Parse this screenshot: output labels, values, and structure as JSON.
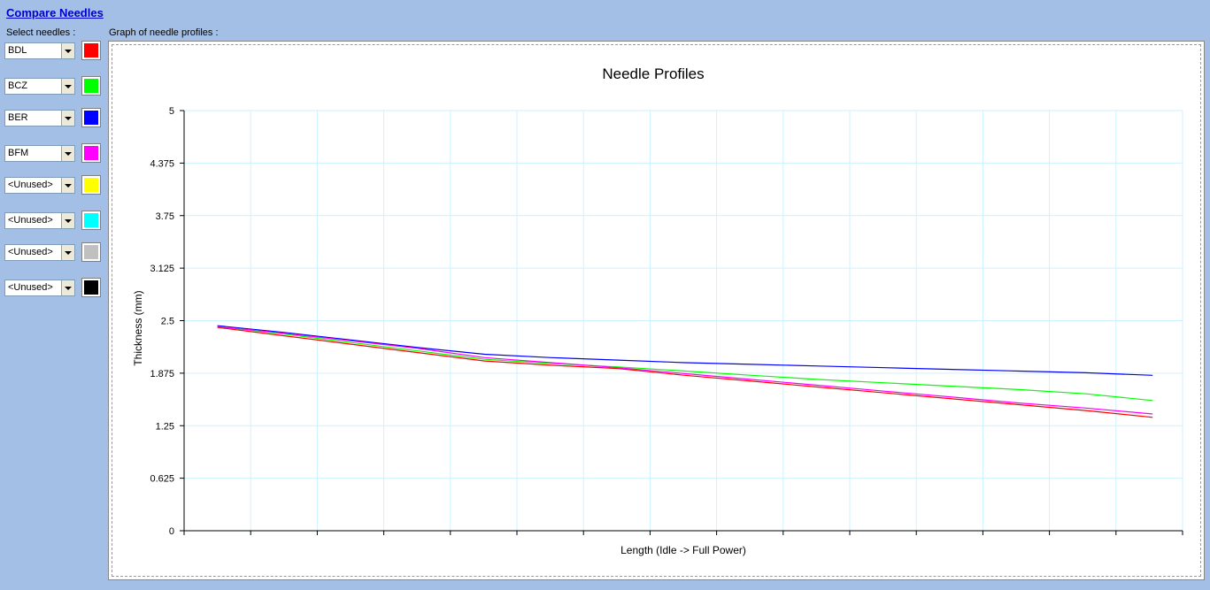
{
  "header": {
    "title": "Compare Needles",
    "select_label": "Select needles :",
    "graph_label": "Graph of needle profiles :"
  },
  "needles": [
    {
      "value": "BDL",
      "color": "#ff0000"
    },
    {
      "value": "BCZ",
      "color": "#00ff00"
    },
    {
      "value": "BER",
      "color": "#0000ff"
    },
    {
      "value": "BFM",
      "color": "#ff00ff"
    },
    {
      "value": "<Unused>",
      "color": "#ffff00"
    },
    {
      "value": "<Unused>",
      "color": "#00ffff"
    },
    {
      "value": "<Unused>",
      "color": "#c0c0c0"
    },
    {
      "value": "<Unused>",
      "color": "#000000"
    }
  ],
  "chart_data": {
    "type": "line",
    "title": "Needle Profiles",
    "xlabel": "Length (Idle -> Full Power)",
    "ylabel": "Thickness (mm)",
    "ylim": [
      0,
      5
    ],
    "y_ticks": [
      "0",
      "0.625",
      "1.25",
      "1.875",
      "2.5",
      "3.125",
      "3.75",
      "4.375",
      "5"
    ],
    "x_tick_count": 16,
    "grid": true,
    "grid_color": "#ccf2ff",
    "x": [
      0,
      1,
      2,
      3,
      4,
      5,
      6,
      7,
      8,
      9,
      10,
      11,
      12,
      13,
      14
    ],
    "series": [
      {
        "name": "BDL",
        "color": "#ff0000",
        "values": [
          2.42,
          2.32,
          2.22,
          2.12,
          2.02,
          1.97,
          1.93,
          1.85,
          1.78,
          1.71,
          1.64,
          1.57,
          1.5,
          1.43,
          1.35
        ]
      },
      {
        "name": "BCZ",
        "color": "#00ff00",
        "values": [
          2.43,
          2.34,
          2.24,
          2.14,
          2.04,
          1.99,
          1.95,
          1.9,
          1.85,
          1.8,
          1.76,
          1.72,
          1.68,
          1.63,
          1.55
        ]
      },
      {
        "name": "BER",
        "color": "#0000ff",
        "values": [
          2.44,
          2.36,
          2.27,
          2.18,
          2.1,
          2.06,
          2.03,
          2.0,
          1.98,
          1.96,
          1.94,
          1.92,
          1.9,
          1.88,
          1.85
        ]
      },
      {
        "name": "BFM",
        "color": "#ff00ff",
        "values": [
          2.43,
          2.35,
          2.26,
          2.17,
          2.06,
          2.0,
          1.94,
          1.87,
          1.8,
          1.73,
          1.66,
          1.59,
          1.52,
          1.46,
          1.39
        ]
      }
    ]
  }
}
